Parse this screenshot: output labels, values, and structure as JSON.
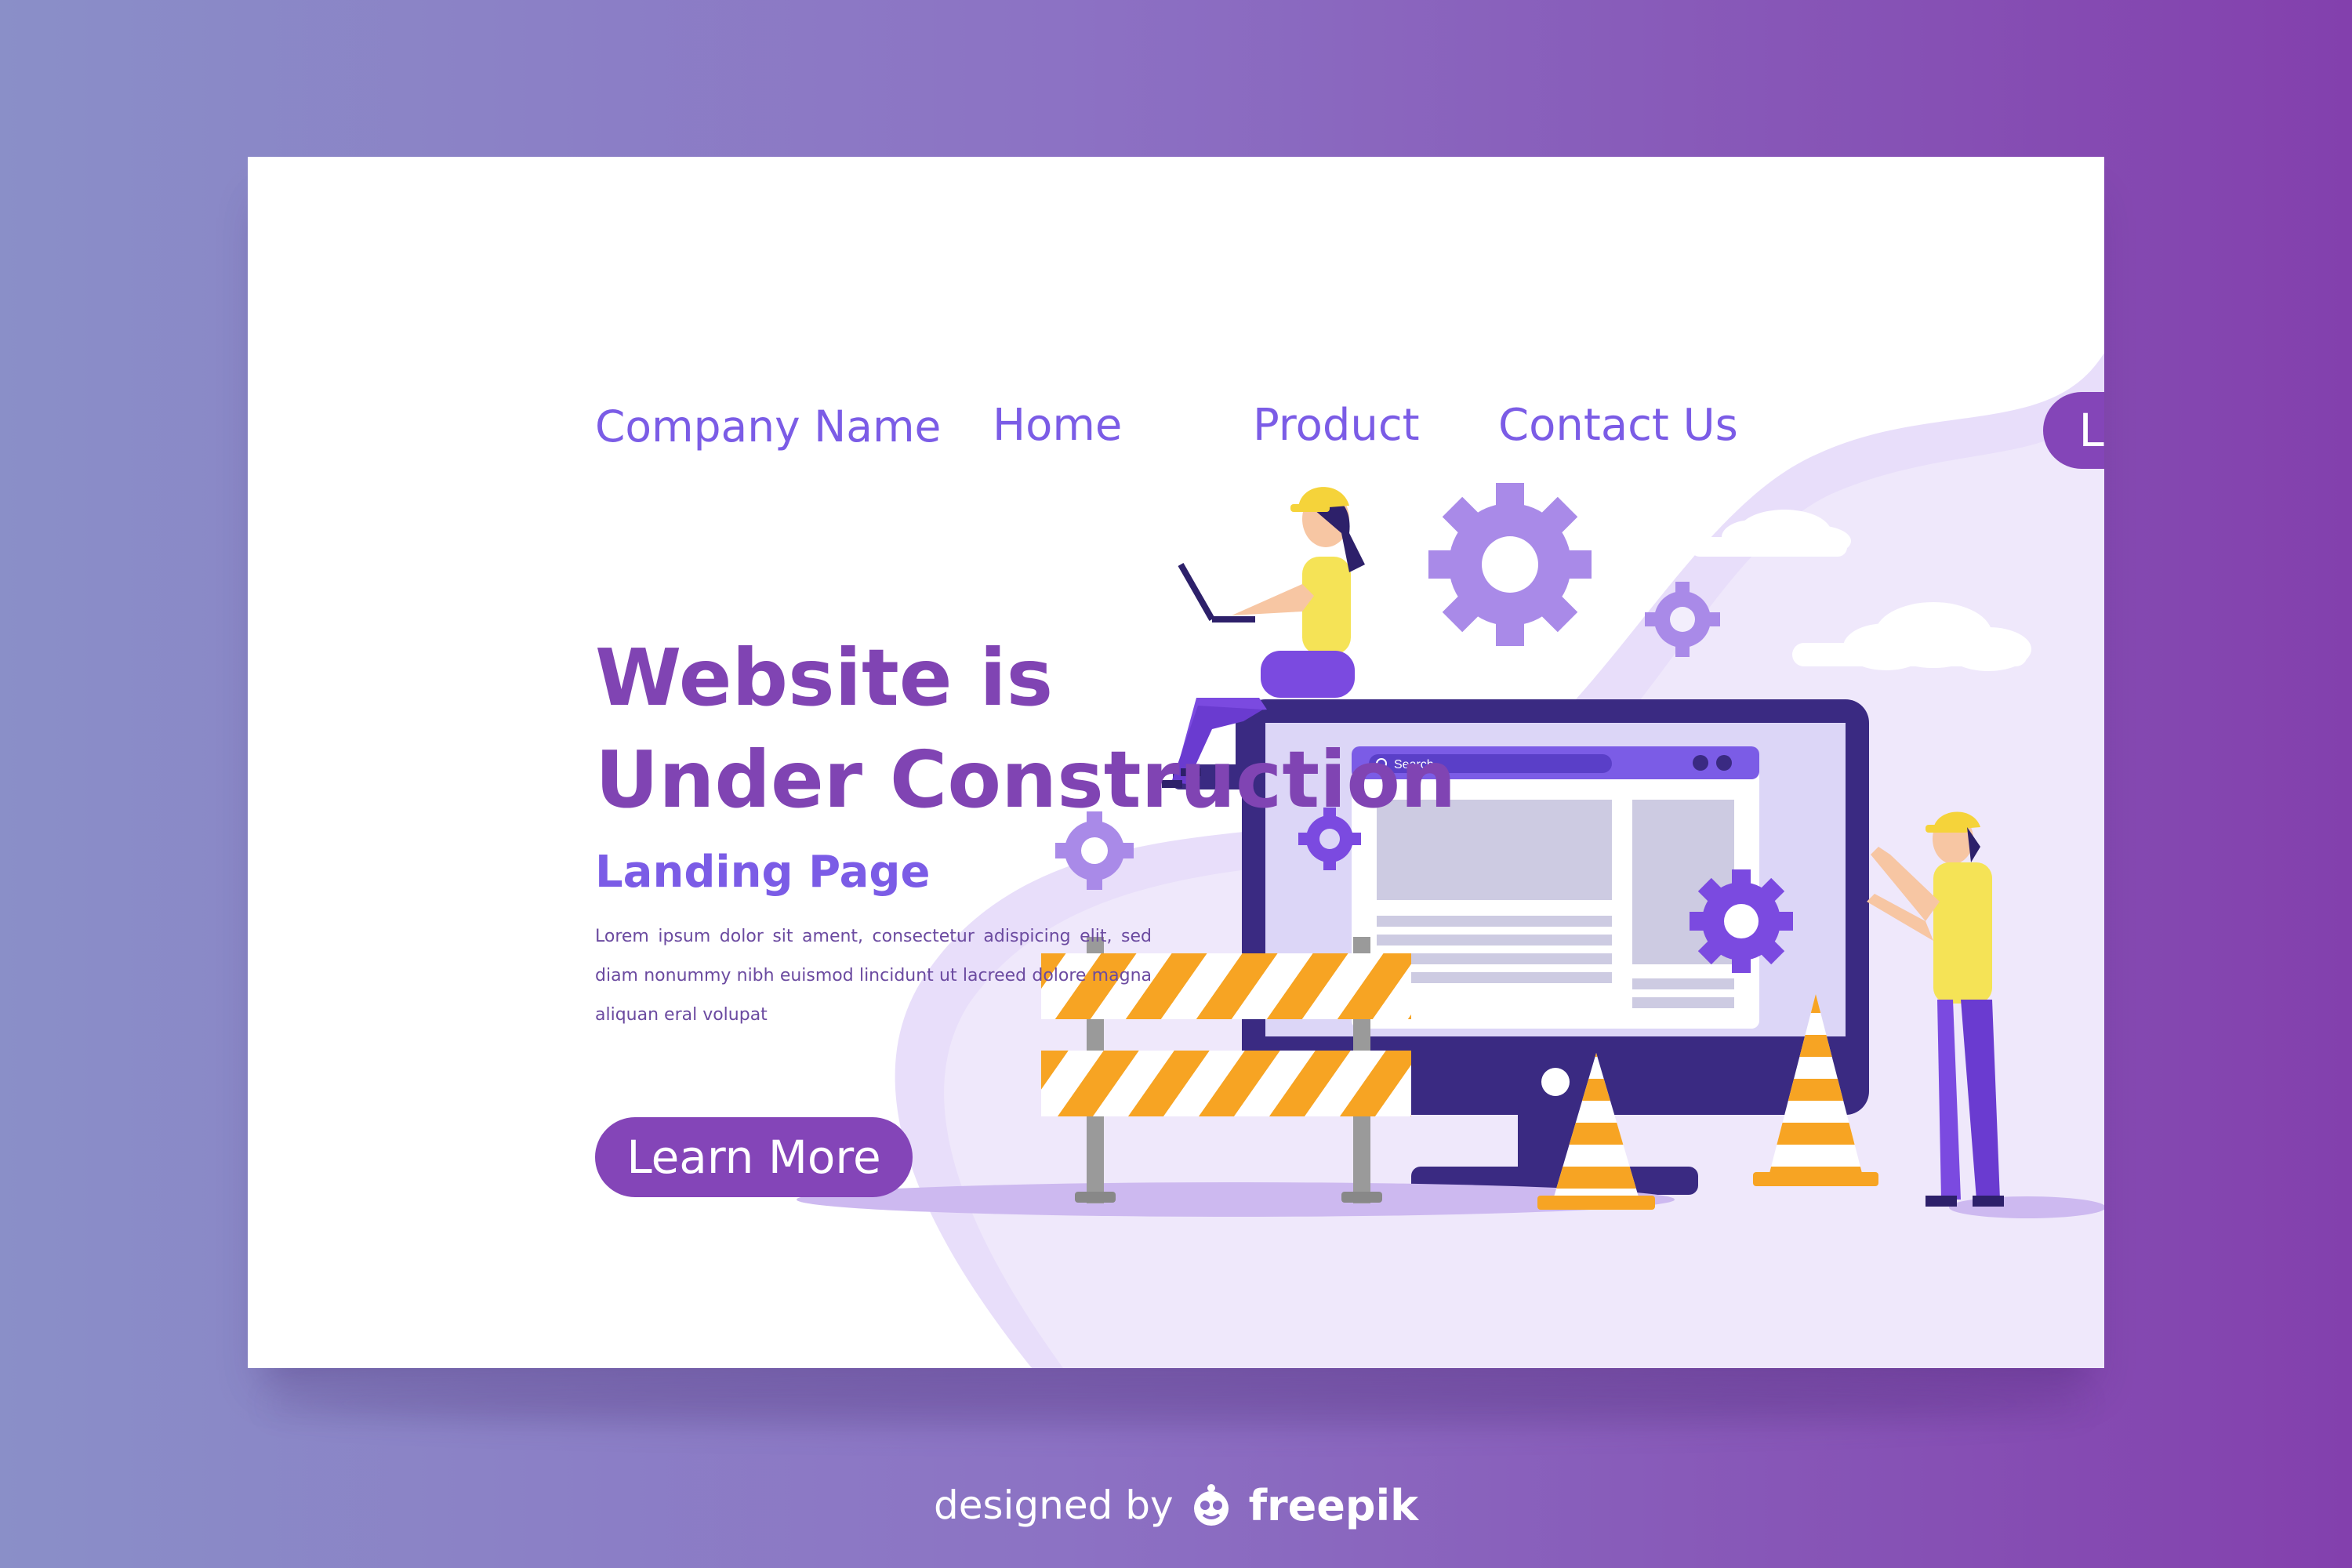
{
  "header": {
    "company_name": "Company Name",
    "nav": [
      {
        "label": "Home"
      },
      {
        "label": "Product"
      },
      {
        "label": "Contact Us"
      }
    ],
    "login_label": "Log in"
  },
  "hero": {
    "headline_line1": "Website is",
    "headline_line2": "Under Construction",
    "subheading": "Landing Page",
    "body": "Lorem ipsum dolor sit ament, consectetur adispicing elit, sed diam nonummy nibh euismod lincidunt ut lacreed dolore magna aliquan eral volupat",
    "cta_label": "Learn More"
  },
  "illustration": {
    "search_placeholder": "Search"
  },
  "footer": {
    "prefix": "designed by",
    "brand": "freepik"
  },
  "colors": {
    "accent": "#8445b8",
    "link": "#7b5ce6",
    "lavender": "#e8defa",
    "monitor_frame": "#3a2a82",
    "hardhat": "#f5d33a",
    "stripe_orange": "#f7a423"
  }
}
